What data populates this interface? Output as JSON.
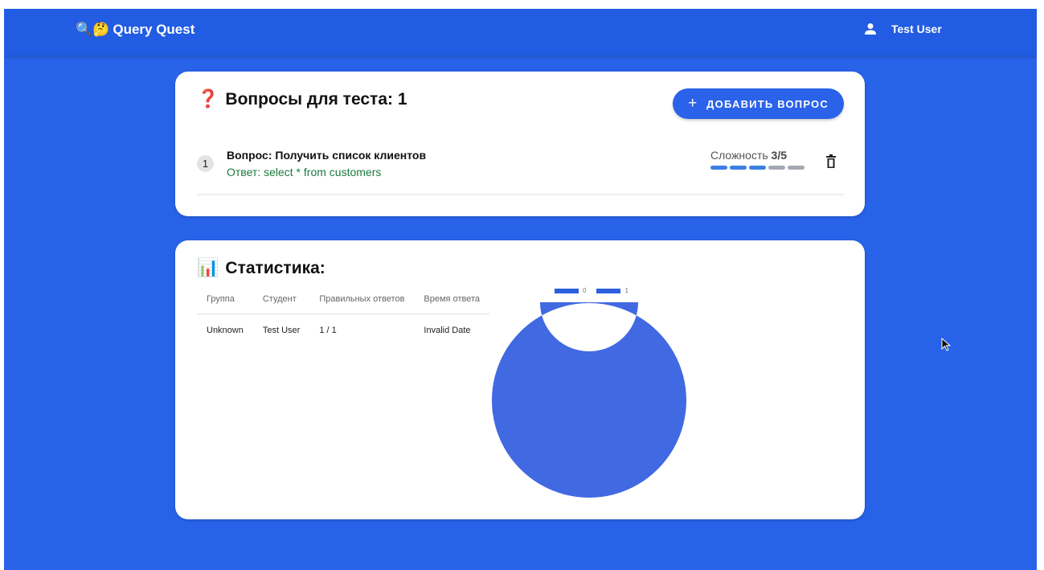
{
  "app": {
    "brand_emoji": "🔍🤔",
    "brand_name": "Query Quest",
    "user_name": "Test User"
  },
  "questions_card": {
    "emoji": "❓",
    "title": "Вопросы для теста: 1",
    "add_button_label": "ДОБАВИТЬ ВОПРОС",
    "items": [
      {
        "number": "1",
        "question": "Вопрос: Получить список клиентов",
        "answer": "Ответ: select * from customers",
        "difficulty_label": "Сложность",
        "difficulty_value": "3/5",
        "difficulty_level": 3,
        "difficulty_max": 5
      }
    ]
  },
  "stats_card": {
    "emoji": "📊",
    "title": "Статистика:",
    "table": {
      "headers": [
        "Группа",
        "Студент",
        "Правильных ответов",
        "Время ответа"
      ],
      "rows": [
        [
          "Unknown",
          "Test User",
          "1 / 1",
          "Invalid Date"
        ]
      ]
    }
  },
  "chart_data": {
    "type": "pie",
    "variant": "doughnut",
    "legend_position": "top",
    "labels": [
      "0",
      "1"
    ],
    "values": [
      0,
      1
    ],
    "colors": [
      "#2c5fdc",
      "#4169e1"
    ]
  },
  "colors": {
    "background": "#2762e8",
    "appbar": "#215ce3",
    "accent": "#2a63ea",
    "answer_text": "#1b7a3e",
    "difficulty_on": "#3b7fe4",
    "difficulty_off": "#a3a8b3"
  }
}
